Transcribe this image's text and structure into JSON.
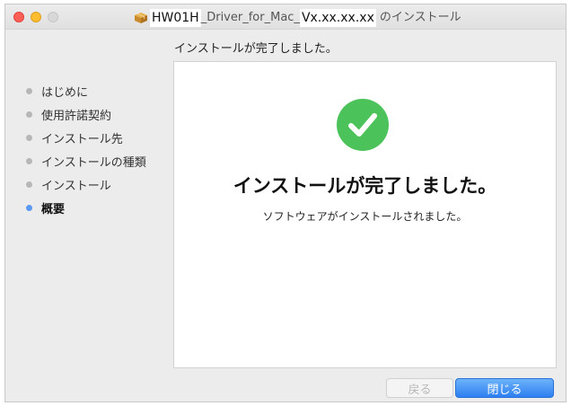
{
  "window": {
    "title_parts": {
      "name": "HW01H",
      "middle": "_Driver_for_Mac_",
      "version": "Vx.xx.xx.xx",
      "suffix": "のインストール"
    }
  },
  "heading": "インストールが完了しました。",
  "sidebar": {
    "items": [
      {
        "label": "はじめに",
        "active": false
      },
      {
        "label": "使用許諾契約",
        "active": false
      },
      {
        "label": "インストール先",
        "active": false
      },
      {
        "label": "インストールの種類",
        "active": false
      },
      {
        "label": "インストール",
        "active": false
      },
      {
        "label": "概要",
        "active": true
      }
    ]
  },
  "main": {
    "icon": "checkmark-circle-icon",
    "title": "インストールが完了しました。",
    "message": "ソフトウェアがインストールされました。"
  },
  "buttons": {
    "back_label": "戻る",
    "close_label": "閉じる"
  },
  "colors": {
    "success_green": "#4cc35a",
    "accent_blue": "#2e7ff1",
    "active_bullet": "#5a9bf1"
  }
}
